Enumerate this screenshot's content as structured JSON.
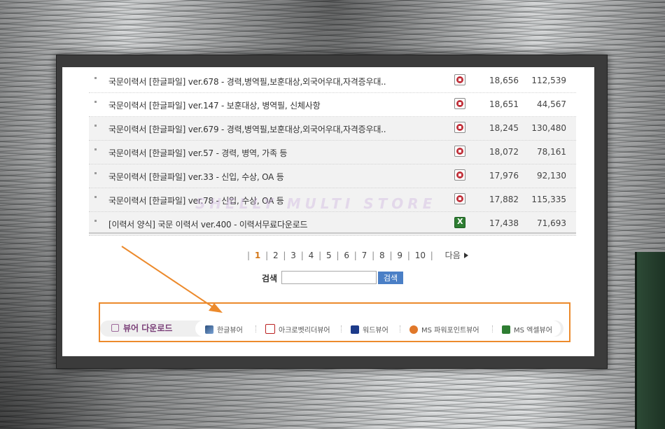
{
  "rows": [
    {
      "title": "국문이력서 [한글파일] ver.678 - 경력,병역필,보훈대상,외국어우대,자격증우대..",
      "file_icon": "hwp-file-icon",
      "count": "18,656",
      "views": "112,539"
    },
    {
      "title": "국문이력서 [한글파일] ver.147 - 보훈대상, 병역필, 신체사항",
      "file_icon": "hwp-file-icon",
      "count": "18,651",
      "views": "44,567"
    },
    {
      "title": "국문이력서 [한글파일] ver.679 - 경력,병역필,보훈대상,외국어우대,자격증우대..",
      "file_icon": "hwp-file-icon",
      "count": "18,245",
      "views": "130,480"
    },
    {
      "title": "국문이력서 [한글파일] ver.57 - 경력, 병역, 가족 등",
      "file_icon": "hwp-file-icon",
      "count": "18,072",
      "views": "78,161"
    },
    {
      "title": "국문이력서 [한글파일] ver.33 - 신입, 수상, OA 등",
      "file_icon": "hwp-file-icon",
      "count": "17,976",
      "views": "92,130"
    },
    {
      "title": "국문이력서 [한글파일] ver.78 - 신입, 수상, OA 등",
      "file_icon": "hwp-file-icon",
      "count": "17,882",
      "views": "115,335"
    },
    {
      "title": "[이력서 양식] 국문 이력서 ver.400 - 이력서무료다운로드",
      "file_icon": "excel-file-icon",
      "count": "17,438",
      "views": "71,693"
    }
  ],
  "watermark": "SHELLY MULTI STORE",
  "pagination": {
    "pages": [
      "1",
      "2",
      "3",
      "4",
      "5",
      "6",
      "7",
      "8",
      "9",
      "10"
    ],
    "current": "1",
    "next_label": "다음"
  },
  "search": {
    "label": "검색",
    "value": "",
    "button_label": "검색"
  },
  "viewer_download": {
    "title": "뷰어 다운로드",
    "links": [
      {
        "label": "한글뷰어",
        "icon": "hangul-viewer-icon"
      },
      {
        "label": "아크로벳리더뷰어",
        "icon": "acrobat-reader-icon"
      },
      {
        "label": "워드뷰어",
        "icon": "word-viewer-icon"
      },
      {
        "label": "MS 파워포인트뷰어",
        "icon": "powerpoint-viewer-icon"
      },
      {
        "label": "MS 엑셀뷰어",
        "icon": "excel-viewer-icon"
      }
    ]
  },
  "colors": {
    "highlight": "#ec8a2c",
    "current_page": "#d4781b",
    "search_button": "#4a7fc6",
    "viewer_title": "#7a3f78"
  }
}
